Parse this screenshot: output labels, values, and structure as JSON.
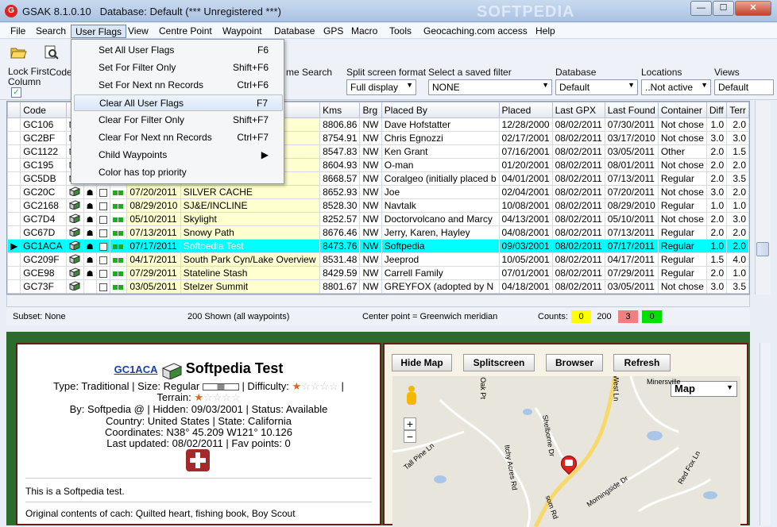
{
  "window": {
    "title": "GSAK 8.1.0.10",
    "subtitle": "Database: Default    (*** Unregistered ***)",
    "watermark": "SOFTPEDIA",
    "min": "—",
    "max": "☐",
    "close": "✕"
  },
  "menu": [
    "File",
    "Search",
    "User Flags",
    "View",
    "Centre Point",
    "Waypoint",
    "Database",
    "GPS",
    "Macro",
    "Tools",
    "Geocaching.com access",
    "Help"
  ],
  "user_flags_menu": [
    {
      "label": "Set All User Flags",
      "shortcut": "F6"
    },
    {
      "label": "Set For Filter Only",
      "shortcut": "Shift+F6"
    },
    {
      "label": "Set For Next nn Records",
      "shortcut": "Ctrl+F6"
    },
    {
      "label": "Clear All User Flags",
      "shortcut": "F7"
    },
    {
      "label": "Clear For Filter Only",
      "shortcut": "Shift+F7"
    },
    {
      "label": "Clear For Next nn Records",
      "shortcut": "Ctrl+F7"
    },
    {
      "label": "Child Waypoints",
      "shortcut": "▶"
    },
    {
      "label": "Color has top priority",
      "shortcut": ""
    }
  ],
  "filters": {
    "lock_first_column": "Lock First Column",
    "code_label": "Code",
    "name_search_label": "me Search",
    "split_label": "Split screen format",
    "split_value": "Full display",
    "saved_filter_label": "Select a saved filter",
    "saved_filter_value": "NONE",
    "database_label": "Database",
    "database_value": "Default",
    "locations_label": "Locations",
    "locations_value": "..Not active",
    "views_label": "Views",
    "views_value": "Default"
  },
  "grid": {
    "columns": [
      "Code",
      "",
      "",
      "",
      "",
      "",
      "",
      "Kms",
      "Brg",
      "Placed By",
      "Placed",
      "Last GPX",
      "Last Found",
      "Container",
      "Diff",
      "Terr"
    ],
    "rows": [
      {
        "code": "GC106",
        "hidden": "",
        "name": "",
        "kms": "8806.86",
        "brg": "NW",
        "by": "Dave Hofstatter",
        "placed": "12/28/2000",
        "gpx": "08/02/2011",
        "found": "07/30/2011",
        "cont": "Not chose",
        "diff": "1.0",
        "terr": "2.0",
        "sel": false,
        "u": false,
        "lock": false
      },
      {
        "code": "GC2BF",
        "hidden": "",
        "name": "",
        "kms": "8754.91",
        "brg": "NW",
        "by": "Chris Egnozzi",
        "placed": "02/17/2001",
        "gpx": "08/02/2011",
        "found": "03/17/2010",
        "cont": "Not chose",
        "diff": "3.0",
        "terr": "3.0",
        "sel": false,
        "u": false,
        "lock": false
      },
      {
        "code": "GC1122",
        "hidden": "",
        "name": "",
        "kms": "8547.83",
        "brg": "NW",
        "by": "Ken Grant",
        "placed": "07/16/2001",
        "gpx": "08/02/2011",
        "found": "03/05/2011",
        "cont": "Other",
        "diff": "2.0",
        "terr": "1.5",
        "sel": false,
        "u": false,
        "lock": false
      },
      {
        "code": "GC195",
        "hidden": "",
        "name": "",
        "kms": "8604.93",
        "brg": "NW",
        "by": "O-man",
        "placed": "01/20/2001",
        "gpx": "08/02/2011",
        "found": "08/01/2011",
        "cont": "Not chose",
        "diff": "2.0",
        "terr": "2.0",
        "sel": false,
        "u": false,
        "lock": false
      },
      {
        "code": "GC5DB",
        "hidden": "",
        "name": "",
        "kms": "8668.57",
        "brg": "NW",
        "by": "Coralgeo (initially placed b",
        "placed": "04/01/2001",
        "gpx": "08/02/2011",
        "found": "07/13/2011",
        "cont": "Regular",
        "diff": "2.0",
        "terr": "3.5",
        "sel": false,
        "u": false,
        "lock": false
      },
      {
        "code": "GC20C",
        "hidden": "07/20/2011",
        "name": "SILVER CACHE",
        "kms": "8652.93",
        "brg": "NW",
        "by": "Joe",
        "placed": "02/04/2001",
        "gpx": "08/02/2011",
        "found": "07/20/2011",
        "cont": "Not chose",
        "diff": "3.0",
        "terr": "2.0",
        "sel": false,
        "u": true,
        "lock": true
      },
      {
        "code": "GC2168",
        "hidden": "08/29/2010",
        "name": "SJ&E/INCLINE",
        "kms": "8528.30",
        "brg": "NW",
        "by": "Navtalk",
        "placed": "10/08/2001",
        "gpx": "08/02/2011",
        "found": "08/29/2010",
        "cont": "Regular",
        "diff": "1.0",
        "terr": "1.0",
        "sel": false,
        "u": false,
        "lock": true
      },
      {
        "code": "GC7D4",
        "hidden": "05/10/2011",
        "name": "Skylight",
        "kms": "8252.57",
        "brg": "NW",
        "by": "Doctorvolcano and Marcy",
        "placed": "04/13/2001",
        "gpx": "08/02/2011",
        "found": "05/10/2011",
        "cont": "Not chose",
        "diff": "2.0",
        "terr": "3.0",
        "sel": false,
        "u": false,
        "lock": true
      },
      {
        "code": "GC67D",
        "hidden": "07/13/2011",
        "name": "Snowy Path",
        "kms": "8676.46",
        "brg": "NW",
        "by": "Jerry, Karen, Hayley",
        "placed": "04/08/2001",
        "gpx": "08/02/2011",
        "found": "07/13/2011",
        "cont": "Regular",
        "diff": "2.0",
        "terr": "2.0",
        "sel": false,
        "u": false,
        "lock": true
      },
      {
        "code": "GC1ACA",
        "hidden": "07/17/2011",
        "name": "Softpedia Test",
        "kms": "8473.76",
        "brg": "NW",
        "by": "Softpedia",
        "placed": "09/03/2001",
        "gpx": "08/02/2011",
        "found": "07/17/2011",
        "cont": "Regular",
        "diff": "1.0",
        "terr": "2.0",
        "sel": true,
        "u": true,
        "lock": true
      },
      {
        "code": "GC209F",
        "hidden": "04/17/2011",
        "name": "South Park Cyn/Lake Overview",
        "kms": "8531.48",
        "brg": "NW",
        "by": "Jeeprod",
        "placed": "10/05/2001",
        "gpx": "08/02/2011",
        "found": "04/17/2011",
        "cont": "Regular",
        "diff": "1.5",
        "terr": "4.0",
        "sel": false,
        "u": false,
        "lock": true
      },
      {
        "code": "GCE98",
        "hidden": "07/29/2011",
        "name": "Stateline Stash",
        "kms": "8429.59",
        "brg": "NW",
        "by": "Carrell Family",
        "placed": "07/01/2001",
        "gpx": "08/02/2011",
        "found": "07/29/2011",
        "cont": "Regular",
        "diff": "2.0",
        "terr": "1.0",
        "sel": false,
        "u": false,
        "lock": true
      },
      {
        "code": "GC73F",
        "hidden": "03/05/2011",
        "name": "Stelzer Summit",
        "kms": "8801.67",
        "brg": "NW",
        "by": "GREYFOX (adopted by N",
        "placed": "04/18/2001",
        "gpx": "08/02/2011",
        "found": "03/05/2011",
        "cont": "Not chose",
        "diff": "3.0",
        "terr": "3.5",
        "sel": false,
        "u": true,
        "lock": false
      }
    ]
  },
  "status": {
    "subset": "Subset: None",
    "shown": "200 Shown (all waypoints)",
    "center": "Center point = Greenwich meridian",
    "counts_label": "Counts:",
    "c1": "0",
    "c2": "200",
    "c3": "3",
    "c4": "0"
  },
  "detail": {
    "code": "GC1ACA",
    "name": "Softpedia Test",
    "type_line": "Type: Traditional | Size: Regular",
    "difficulty": "| Difficulty:",
    "terrain": "Terrain:",
    "by_line": "By: Softpedia @ | Hidden: 09/03/2001 | Status: Available",
    "country": "Country: United States | State: California",
    "coords": "Coordinates: N38° 45.209 W121° 10.126",
    "updated": "Last updated: 08/02/2011 | Fav points: 0",
    "desc": "This is a Softpedia test.",
    "contents": "Original contents of cach: Quilted heart, fishing book, Boy Scout",
    "colors": {
      "available": "#1a7a1a",
      "link": "#1a3fb0",
      "star": "#d9691e"
    }
  },
  "map": {
    "hide": "Hide Map",
    "split": "Splitscreen",
    "browser": "Browser",
    "refresh": "Refresh",
    "type": "Map",
    "streets": [
      "Oak Pt",
      "Tall Pine Ln",
      "Itchy Acres Rd",
      "Shelborne Dr",
      "West Ln",
      "Morningside Dr",
      "Red Fox Ln",
      "Minersville",
      "som Rd"
    ]
  }
}
